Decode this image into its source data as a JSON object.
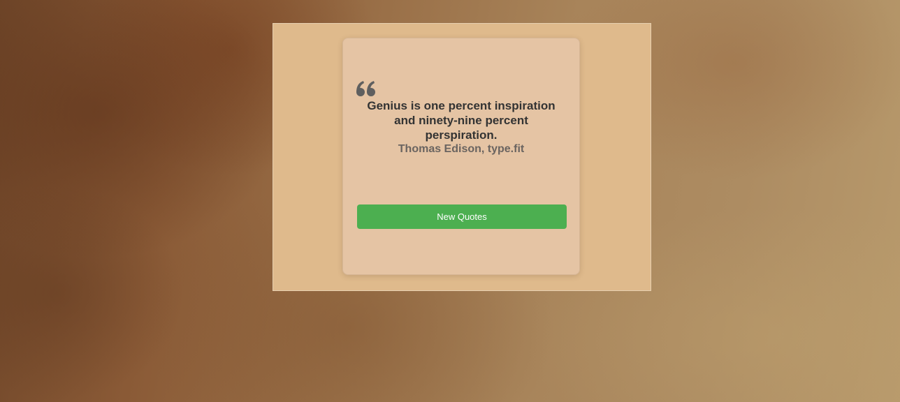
{
  "quote": {
    "text": "Genius is one percent inspiration and ninety-nine percent perspiration.",
    "author": "Thomas Edison, type.fit",
    "icon": "quote-left-icon"
  },
  "actions": {
    "new_quote_label": "New Quotes"
  },
  "colors": {
    "frame_background": "#dfba8c",
    "card_background": "#e5c4a4",
    "button_background": "#4caf50",
    "quote_text": "#333333",
    "author_text": "#6a6460"
  }
}
